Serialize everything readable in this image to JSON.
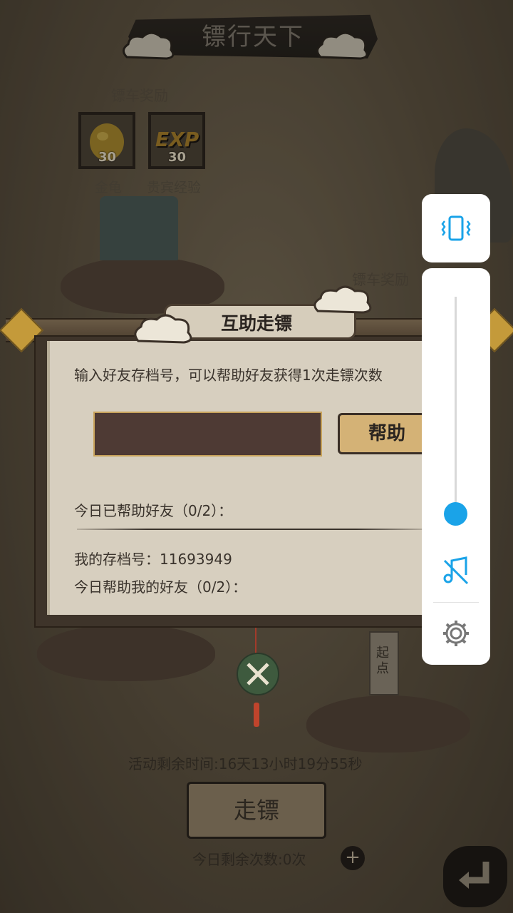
{
  "header": {
    "title": "镖行天下"
  },
  "rewards_left": {
    "label": "镖车奖励",
    "items": [
      {
        "name": "金龟",
        "count": "30",
        "icon": "golden-turtle-icon"
      },
      {
        "name": "贵宾经验",
        "count": "30",
        "icon": "exp-icon",
        "badge": "EXP"
      }
    ]
  },
  "rewards_right": {
    "label": "镖车奖励"
  },
  "dialog": {
    "title": "互助走镖",
    "description": "输入好友存档号，可以帮助好友获得1次走镖次数",
    "input": {
      "value": "",
      "placeholder": ""
    },
    "help_button": "帮助",
    "helped_today": "今日已帮助好友（0/2）：",
    "my_id_label": "我的存档号：",
    "my_id": "11693949",
    "helped_me": "今日帮助我的好友（0/2）："
  },
  "stone": {
    "text": "起点"
  },
  "footer": {
    "timer": "活动剩余时间:16天13小时19分55秒",
    "go_button": "走镖",
    "remaining": "今日剩余次数:0次",
    "plus": "+"
  },
  "system_overlay": {
    "volume_level": 0.05,
    "icons": [
      "vibrate-icon",
      "music-muted-icon",
      "settings-gear-icon"
    ],
    "accent": "#1aa3e8"
  }
}
